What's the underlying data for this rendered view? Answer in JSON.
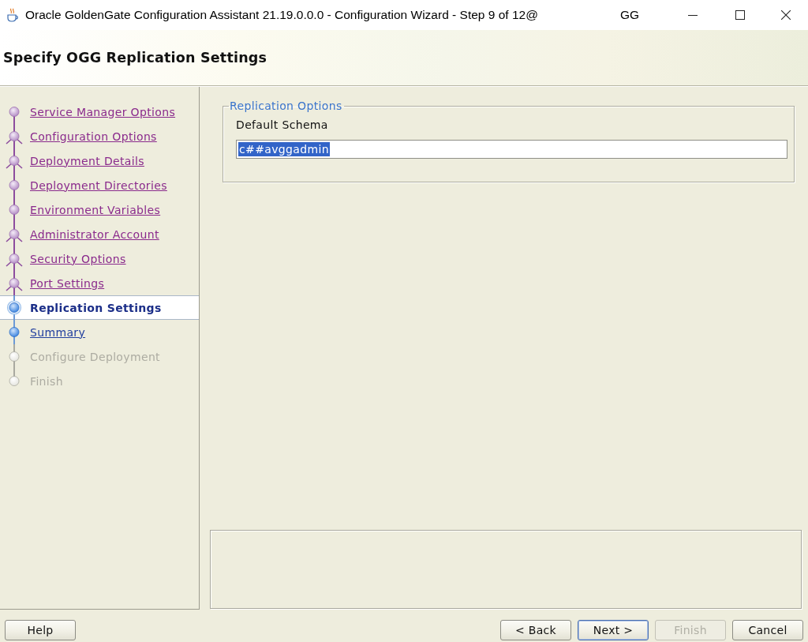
{
  "window": {
    "title": "Oracle GoldenGate Configuration Assistant 21.19.0.0.0 - Configuration Wizard - Step 9 of 12@",
    "host_label": "GG"
  },
  "header": {
    "title": "Specify OGG Replication Settings"
  },
  "steps": [
    {
      "label": "Service Manager Options",
      "visited": true,
      "disabled": false,
      "kind": "plain",
      "selected": false
    },
    {
      "label": "Configuration Options",
      "visited": true,
      "disabled": false,
      "kind": "branch",
      "selected": false
    },
    {
      "label": "Deployment Details",
      "visited": true,
      "disabled": false,
      "kind": "branch",
      "selected": false
    },
    {
      "label": "Deployment Directories",
      "visited": true,
      "disabled": false,
      "kind": "plain",
      "selected": false
    },
    {
      "label": "Environment Variables",
      "visited": true,
      "disabled": false,
      "kind": "plain",
      "selected": false
    },
    {
      "label": "Administrator Account",
      "visited": true,
      "disabled": false,
      "kind": "branch",
      "selected": false
    },
    {
      "label": "Security Options",
      "visited": true,
      "disabled": false,
      "kind": "branch",
      "selected": false
    },
    {
      "label": "Port Settings",
      "visited": true,
      "disabled": false,
      "kind": "branch",
      "selected": false
    },
    {
      "label": "Replication Settings",
      "visited": false,
      "disabled": false,
      "kind": "plain",
      "selected": true
    },
    {
      "label": "Summary",
      "visited": false,
      "disabled": false,
      "kind": "plain",
      "selected": false
    },
    {
      "label": "Configure Deployment",
      "visited": false,
      "disabled": true,
      "kind": "plain",
      "selected": false
    },
    {
      "label": "Finish",
      "visited": false,
      "disabled": true,
      "kind": "plain",
      "selected": false
    }
  ],
  "replication_options": {
    "legend": "Replication Options",
    "default_schema": {
      "label": "Default Schema",
      "value": "c##avggadmin",
      "highlighted": true
    }
  },
  "buttons_left": [
    {
      "label": "Help",
      "disabled": false,
      "default": false
    }
  ],
  "buttons_right": [
    {
      "label": "< Back",
      "disabled": false,
      "default": false
    },
    {
      "label": "Next >",
      "disabled": false,
      "default": true
    },
    {
      "label": "Finish",
      "disabled": true,
      "default": false
    },
    {
      "label": "Cancel",
      "disabled": false,
      "default": false
    }
  ]
}
